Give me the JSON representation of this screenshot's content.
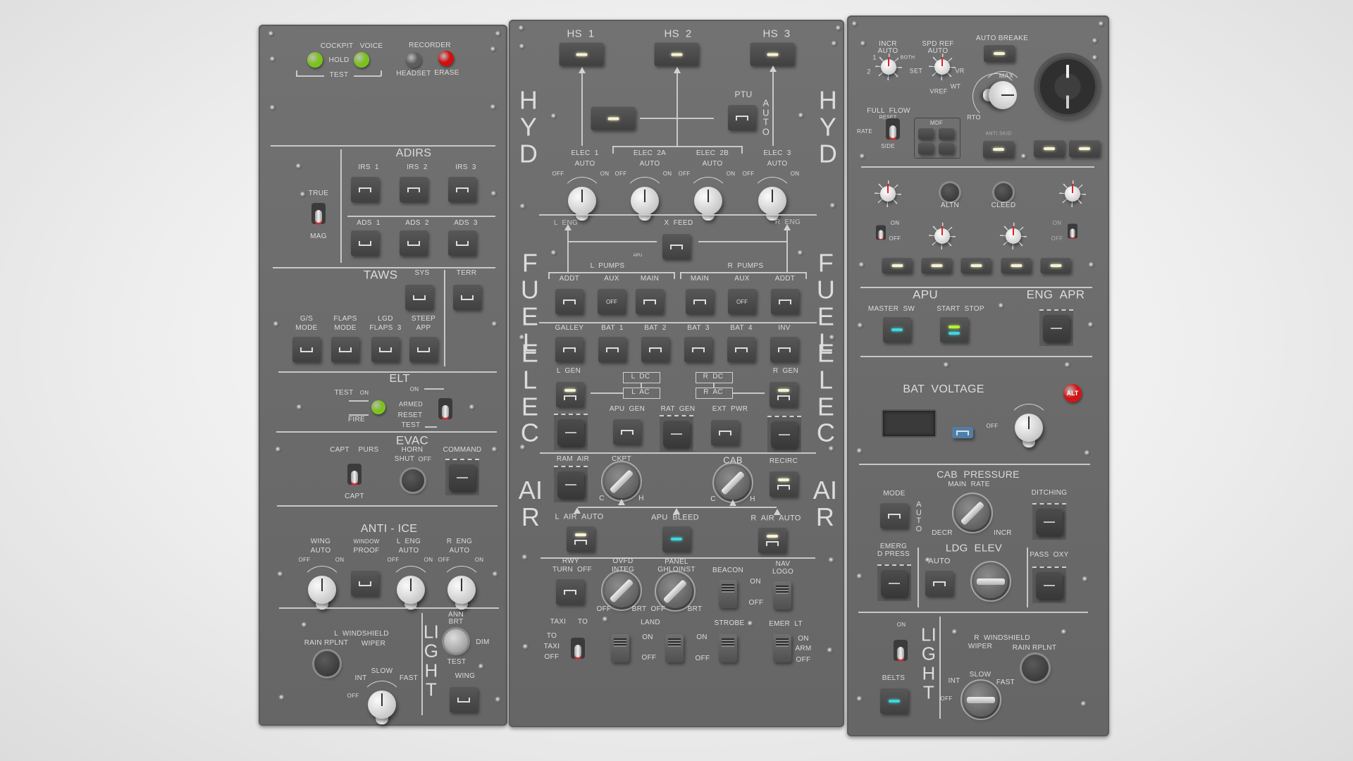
{
  "left": {
    "cvr": {
      "cockpit": "COCKPIT",
      "voice": "VOICE",
      "hold": "HOLD",
      "test": "TEST",
      "recorder": "RECORDER",
      "headset": "HEADSET",
      "erase": "ERASE"
    },
    "adirs": {
      "title": "ADIRS",
      "true": "TRUE",
      "mag": "MAG",
      "irs": [
        "IRS  1",
        "IRS  2",
        "IRS  3"
      ],
      "ads": [
        "ADS  1",
        "ADS  2",
        "ADS  3"
      ]
    },
    "taws": {
      "title": "TAWS",
      "sys": "SYS",
      "terr": "TERR",
      "gs_mode": [
        "G/S",
        "MODE"
      ],
      "flaps_mode": [
        "FLAPS",
        "MODE"
      ],
      "lgd_flaps": [
        "LGD",
        "FLAPS  3"
      ],
      "steep_app": [
        "STEEP",
        "APP"
      ]
    },
    "elt": {
      "title": "ELT",
      "test": "TEST",
      "on": "ON",
      "fire": "FIRE",
      "sw_on": "ON",
      "armed": "ARMED",
      "reset": "RESET",
      "sw_test": "TEST"
    },
    "evac": {
      "title": "EVAC",
      "capt": "CAPT",
      "purs": "PURS",
      "horn": "HORN",
      "shut": "SHUT",
      "off": "OFF",
      "command": "COMMAND",
      "capt_pos": "CAPT"
    },
    "anti_ice": {
      "title": "ANTI - ICE",
      "wing": [
        "WING",
        "AUTO"
      ],
      "window": [
        "WINDOW",
        "PROOF"
      ],
      "l_eng": [
        "L  ENG",
        "AUTO"
      ],
      "r_eng": [
        "R  ENG",
        "AUTO"
      ],
      "off": "OFF",
      "on": "ON"
    },
    "wiper": {
      "l_windshield": "L  WINDSHIELD",
      "rain_rplnt": "RAIN RPLNT",
      "wiper": "WIPER",
      "int": "INT",
      "slow": "SLOW",
      "fast": "FAST",
      "off": "OFF"
    },
    "light": {
      "title": "LIGHT",
      "ann_brt": [
        "ANN",
        "BRT"
      ],
      "dim": "DIM",
      "test": "TEST",
      "wing": "WING"
    }
  },
  "center": {
    "hyd": {
      "title": "HYD",
      "hs": [
        "HS  1",
        "HS  2",
        "HS  3"
      ],
      "ptu": "PTU",
      "auto": "AUTO",
      "elec": [
        "ELEC  1",
        "ELEC  2A",
        "ELEC  2B",
        "ELEC  3"
      ],
      "auto_lbl": "AUTO",
      "off": "OFF",
      "on": "ON"
    },
    "fuel": {
      "title": "FUEL",
      "l_eng": "L  ENG",
      "x_feed": "X  FEED",
      "r_eng": "R  ENG",
      "apu": "APU",
      "l_pumps": "L  PUMPS",
      "r_pumps": "R  PUMPS",
      "pumps": [
        "ADDT",
        "AUX",
        "MAIN",
        "MAIN",
        "AUX",
        "ADDT"
      ],
      "off": "OFF"
    },
    "elec": {
      "title": "ELEC",
      "loads": [
        "GALLEY",
        "BAT  1",
        "BAT  2",
        "BAT  3",
        "BAT  4",
        "INV"
      ],
      "l_gen": "L  GEN",
      "r_gen": "R  GEN",
      "l_dc": "L  DC",
      "l_ac": "L  AC",
      "r_dc": "R  DC",
      "r_ac": "R  AC",
      "apu_gen": "APU  GEN",
      "rat_gen": "RAT  GEN",
      "ext_pwr": "EXT  PWR"
    },
    "air": {
      "title": "AIR",
      "ram_air": "RAM  AIR",
      "ckpt": "CKPT",
      "cab": "CAB",
      "recirc": "RECIRC",
      "c": "C",
      "h": "H",
      "l_air_auto": "L  AIR  AUTO",
      "apu_bleed": "APU  BLEED",
      "r_air_auto": "R  AIR  AUTO"
    },
    "lights": {
      "rwy": "RWY",
      "turn_off": "TURN  OFF",
      "ovfd": [
        "OVFD",
        "INTEG"
      ],
      "panel": [
        "PANEL",
        "GHLOINST"
      ],
      "off": "OFF",
      "brt": "BRT",
      "beacon": "BEACON",
      "nav": [
        "NAV",
        "LOGO"
      ],
      "on": "ON",
      "taxi": "TAXI",
      "to": "TO",
      "land": "LAND",
      "strobe": "STROBE",
      "emer_lt": "EMER  LT",
      "taxi_sw": [
        "TO",
        "TAXI",
        "OFF"
      ],
      "arm": "ARM"
    }
  },
  "right": {
    "brakes": {
      "incr": [
        "INCR",
        "AUTO"
      ],
      "one": "1",
      "two": "2",
      "both": "BOTH",
      "spd_ref": [
        "SPD REF",
        "AUTO"
      ],
      "set": "SET",
      "vr": "VR",
      "wt": "WT",
      "vref": "VREF",
      "auto_breake": "AUTO BREAKE",
      "max": "MAX",
      "rto": "RTO",
      "full_flow": "FULL  FLOW",
      "reset": "RESET",
      "rate": "RATE",
      "side": "SIDE",
      "mdf": "MDF",
      "anti_skid": "ANTI SKID"
    },
    "bleed": {
      "altn": "ALTN",
      "cleed": "CLEED",
      "on": "ON",
      "off": "OFF"
    },
    "apu": {
      "title": "APU",
      "master_sw": "MASTER  SW",
      "start_stop": "START  STOP",
      "eng_apr": "ENG  APR"
    },
    "bat": {
      "title": "BAT  VOLTAGE",
      "off": "OFF",
      "alt": "ALT"
    },
    "cab_pressure": {
      "title": "CAB  PRESSURE",
      "main_rate": "MAIN  RATE",
      "mode": "MODE",
      "auto": "AUTO",
      "decr": "DECR",
      "incr": "INCR",
      "ditching": "DITCHING",
      "emerg": [
        "EMERG",
        "D PRESS"
      ],
      "ldg_elev": "LDG  ELEV",
      "ldg_auto": "AUTO",
      "pass_oxy": "PASS  OXY"
    },
    "light": {
      "title": "LIGHT",
      "on": "ON",
      "belts": "BELTS",
      "r_windshield": "R  WINDSHIELD",
      "wiper": "WIPER",
      "rain_rplnt": "RAIN RPLNT",
      "int": "INT",
      "slow": "SLOW",
      "fast": "FAST",
      "off": "OFF"
    }
  },
  "colors": {
    "panel": "#6e6e6e",
    "label": "#dcdcdc",
    "annunciator_white": "#f6f3cf",
    "annunciator_cyan": "#3fd6de",
    "annunciator_green": "#b8f03a",
    "led_green": "#7cc21e",
    "led_red": "#d00f0f",
    "alt_red": "#d41414",
    "blue_button": "#4f7fa8"
  }
}
